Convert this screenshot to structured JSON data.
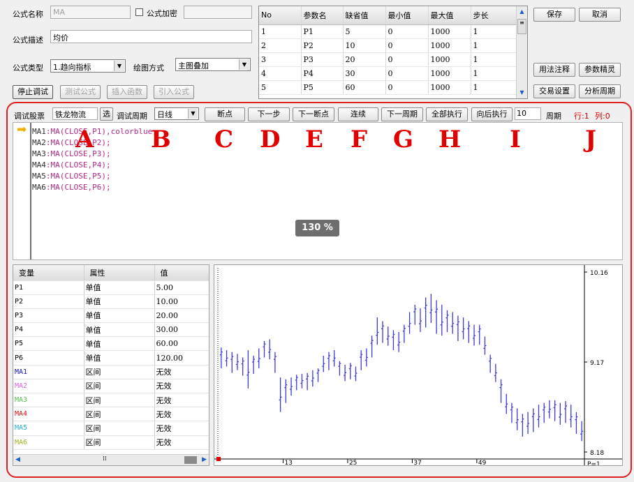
{
  "top": {
    "formula_name_label": "公式名称",
    "formula_name_value": "MA",
    "encrypt_label": "公式加密",
    "formula_desc_label": "公式描述",
    "formula_desc_value": "均价",
    "formula_type_label": "公式类型",
    "formula_type_value": "1.趋向指标",
    "draw_mode_label": "绘图方式",
    "draw_mode_value": "主图叠加",
    "buttons": {
      "stop_debug": "停止调试",
      "test_formula": "测试公式",
      "insert_func": "插入函数",
      "import_formula": "引入公式",
      "save": "保存",
      "cancel": "取消",
      "usage_notes": "用法注释",
      "param_wizard": "参数精灵",
      "trade_settings": "交易设置",
      "analysis_period": "分析周期"
    }
  },
  "params": {
    "headers": [
      "No",
      "参数名",
      "缺省值",
      "最小值",
      "最大值",
      "步长"
    ],
    "rows": [
      [
        "1",
        "P1",
        "5",
        "0",
        "1000",
        "1"
      ],
      [
        "2",
        "P2",
        "10",
        "0",
        "1000",
        "1"
      ],
      [
        "3",
        "P3",
        "20",
        "0",
        "1000",
        "1"
      ],
      [
        "4",
        "P4",
        "30",
        "0",
        "1000",
        "1"
      ],
      [
        "5",
        "P5",
        "60",
        "0",
        "1000",
        "1"
      ]
    ]
  },
  "debug": {
    "stock_label": "调试股票",
    "stock_value": "铁龙物流",
    "select_btn": "选",
    "period_label": "调试周期",
    "period_value": "日线",
    "breakpoint": "断点",
    "next_step": "下一步",
    "next_breakpoint": "下一断点",
    "continue": "连续",
    "next_period": "下一周期",
    "run_all": "全部执行",
    "run_forward": "向后执行",
    "forward_count": "10",
    "period_unit": "周期",
    "row_label": "行:1",
    "col_label": "列:0",
    "letters": [
      "A",
      "B",
      "C",
      "D",
      "E",
      "F",
      "G",
      "H",
      "I",
      "J"
    ]
  },
  "code_lines": [
    {
      "name": "MA1",
      "expr": ":MA(CLOSE,P1),colorblue;"
    },
    {
      "name": "MA2",
      "expr": ":MA(CLOSE,P2);"
    },
    {
      "name": "MA3",
      "expr": ":MA(CLOSE,P3);"
    },
    {
      "name": "MA4",
      "expr": ":MA(CLOSE,P4);"
    },
    {
      "name": "MA5",
      "expr": ":MA(CLOSE,P5);"
    },
    {
      "name": "MA6",
      "expr": ":MA(CLOSE,P6);"
    }
  ],
  "zoom_badge": "130 %",
  "vars": {
    "headers": [
      "变量",
      "属性",
      "值"
    ],
    "rows": [
      {
        "name": "P1",
        "attr": "单值",
        "value": "5.00",
        "color": "#000000"
      },
      {
        "name": "P2",
        "attr": "单值",
        "value": "10.00",
        "color": "#000000"
      },
      {
        "name": "P3",
        "attr": "单值",
        "value": "20.00",
        "color": "#000000"
      },
      {
        "name": "P4",
        "attr": "单值",
        "value": "30.00",
        "color": "#000000"
      },
      {
        "name": "P5",
        "attr": "单值",
        "value": "60.00",
        "color": "#000000"
      },
      {
        "name": "P6",
        "attr": "单值",
        "value": "120.00",
        "color": "#000000"
      },
      {
        "name": "MA1",
        "attr": "区间",
        "value": "无效",
        "color": "#1010d0"
      },
      {
        "name": "MA2",
        "attr": "区间",
        "value": "无效",
        "color": "#e060e0"
      },
      {
        "name": "MA3",
        "attr": "区间",
        "value": "无效",
        "color": "#50c050"
      },
      {
        "name": "MA4",
        "attr": "区间",
        "value": "无效",
        "color": "#e01010"
      },
      {
        "name": "MA5",
        "attr": "区间",
        "value": "无效",
        "color": "#20b0d0"
      },
      {
        "name": "MA6",
        "attr": "区间",
        "value": "无效",
        "color": "#a0b020"
      }
    ]
  },
  "chart_data": {
    "type": "ohlc",
    "y_ticks": [
      "10.16",
      "9.17",
      "8.18"
    ],
    "x_ticks": [
      "13",
      "25",
      "37",
      "49"
    ],
    "x_tick_index": [
      13,
      25,
      37,
      49
    ],
    "corner_label": "P=1",
    "ylim": [
      8.18,
      10.16
    ],
    "bar_color": "#3a3ad8",
    "bars": [
      [
        9.1,
        9.33
      ],
      [
        9.12,
        9.3
      ],
      [
        9.05,
        9.28
      ],
      [
        9.08,
        9.26
      ],
      [
        9.02,
        9.22
      ],
      [
        8.88,
        9.3
      ],
      [
        9.04,
        9.24
      ],
      [
        9.1,
        9.32
      ],
      [
        9.22,
        9.4
      ],
      [
        9.2,
        9.42
      ],
      [
        9.05,
        9.28
      ],
      [
        8.62,
        9.0
      ],
      [
        8.72,
        8.98
      ],
      [
        8.8,
        9.0
      ],
      [
        8.86,
        9.03
      ],
      [
        8.88,
        9.04
      ],
      [
        8.86,
        9.05
      ],
      [
        8.9,
        9.08
      ],
      [
        8.95,
        9.1
      ],
      [
        9.06,
        9.24
      ],
      [
        9.08,
        9.28
      ],
      [
        9.12,
        9.3
      ],
      [
        9.02,
        9.18
      ],
      [
        8.96,
        9.14
      ],
      [
        8.98,
        9.16
      ],
      [
        8.96,
        9.12
      ],
      [
        9.08,
        9.3
      ],
      [
        9.12,
        9.32
      ],
      [
        9.22,
        9.46
      ],
      [
        9.36,
        9.66
      ],
      [
        9.38,
        9.62
      ],
      [
        9.35,
        9.56
      ],
      [
        9.3,
        9.52
      ],
      [
        9.28,
        9.5
      ],
      [
        9.38,
        9.58
      ],
      [
        9.48,
        9.72
      ],
      [
        9.58,
        9.8
      ],
      [
        9.5,
        9.76
      ],
      [
        9.55,
        9.88
      ],
      [
        9.6,
        9.92
      ],
      [
        9.48,
        9.85
      ],
      [
        9.46,
        9.8
      ],
      [
        9.5,
        9.74
      ],
      [
        9.48,
        9.72
      ],
      [
        9.4,
        9.68
      ],
      [
        9.42,
        9.66
      ],
      [
        9.38,
        9.62
      ],
      [
        9.35,
        9.58
      ],
      [
        9.36,
        9.58
      ],
      [
        9.25,
        9.45
      ],
      [
        9.05,
        9.25
      ],
      [
        8.95,
        9.15
      ],
      [
        8.72,
        8.98
      ],
      [
        8.6,
        8.82
      ],
      [
        8.5,
        8.72
      ],
      [
        8.42,
        8.66
      ],
      [
        8.35,
        8.6
      ],
      [
        8.38,
        8.62
      ],
      [
        8.4,
        8.66
      ],
      [
        8.45,
        8.7
      ],
      [
        8.5,
        8.72
      ],
      [
        8.55,
        8.75
      ],
      [
        8.52,
        8.75
      ],
      [
        8.48,
        8.72
      ],
      [
        8.5,
        8.74
      ],
      [
        8.45,
        8.7
      ],
      [
        8.38,
        8.62
      ],
      [
        8.3,
        8.52
      ]
    ]
  }
}
